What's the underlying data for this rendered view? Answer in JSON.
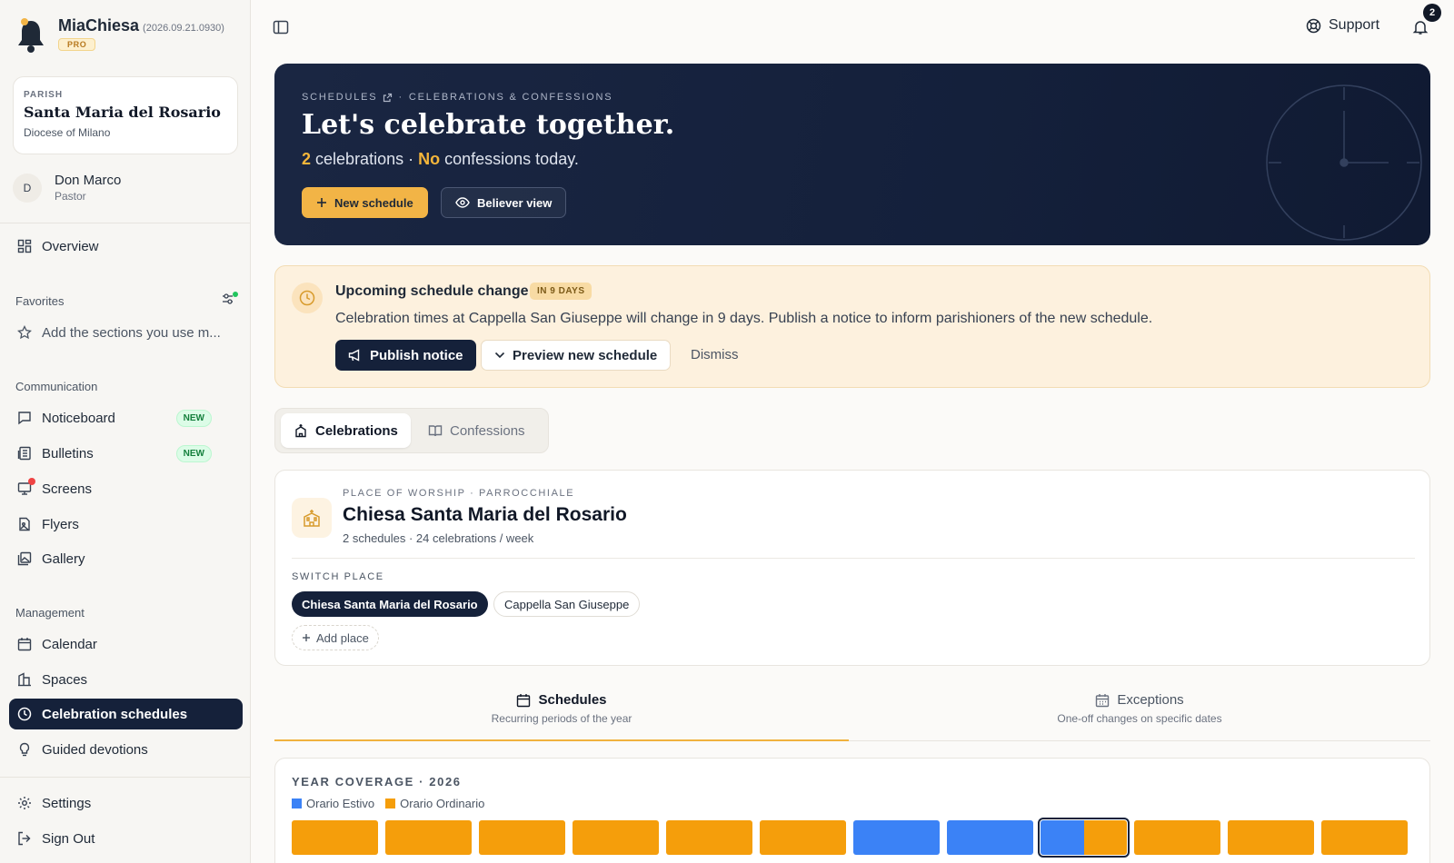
{
  "app": {
    "name": "MiaChiesa",
    "version": "(2026.09.21.0930)",
    "plan": "PRO"
  },
  "parish": {
    "kicker": "PARISH",
    "name": "Santa Maria del Rosario",
    "diocese": "Diocese of Milano"
  },
  "user": {
    "initial": "D",
    "name": "Don Marco",
    "role": "Pastor"
  },
  "sidebar": {
    "overview": "Overview",
    "favorites_heading": "Favorites",
    "favorites_hint": "Add the sections you use m...",
    "communication_heading": "Communication",
    "communication": [
      {
        "label": "Noticeboard",
        "badge": "NEW"
      },
      {
        "label": "Bulletins",
        "badge": "NEW"
      },
      {
        "label": "Screens"
      },
      {
        "label": "Flyers"
      },
      {
        "label": "Gallery"
      }
    ],
    "management_heading": "Management",
    "management": [
      {
        "label": "Calendar"
      },
      {
        "label": "Spaces"
      },
      {
        "label": "Celebration schedules"
      },
      {
        "label": "Guided devotions"
      }
    ],
    "settings": "Settings",
    "sign_out": "Sign Out"
  },
  "topbar": {
    "support": "Support",
    "notifications_count": "2"
  },
  "hero": {
    "crumb_1": "SCHEDULES",
    "crumb_sep": "·",
    "crumb_2": "CELEBRATIONS & CONFESSIONS",
    "title": "Let's celebrate together.",
    "sub_count": "2",
    "sub_mid": "celebrations ·",
    "sub_no": "No",
    "sub_end": "confessions today.",
    "new_schedule": "New schedule",
    "believer_view": "Believer view"
  },
  "notice": {
    "title": "Upcoming schedule change",
    "badge": "IN 9 DAYS",
    "text": "Celebration times at Cappella San Giuseppe will change in 9 days. Publish a notice to inform parishioners of the new schedule.",
    "publish": "Publish notice",
    "preview": "Preview new schedule",
    "dismiss": "Dismiss"
  },
  "tabs": {
    "celebrations": "Celebrations",
    "confessions": "Confessions"
  },
  "place": {
    "kicker": "PLACE OF WORSHIP · PARROCCHIALE",
    "name": "Chiesa Santa Maria del Rosario",
    "meta": "2 schedules · 24 celebrations / week",
    "switch_heading": "SWITCH PLACE",
    "chips": [
      "Chiesa Santa Maria del Rosario",
      "Cappella San Giuseppe"
    ],
    "add_place": "Add place"
  },
  "subtabs": {
    "schedules": {
      "title": "Schedules",
      "desc": "Recurring periods of the year"
    },
    "exceptions": {
      "title": "Exceptions",
      "desc": "One-off changes on specific dates"
    }
  },
  "coverage": {
    "heading": "YEAR COVERAGE · 2026",
    "legend": [
      {
        "label": "Orario Estivo",
        "color": "#3b82f6"
      },
      {
        "label": "Orario Ordinario",
        "color": "#f59e0b"
      }
    ],
    "months": [
      {
        "estivo": 0,
        "ordinario": 1
      },
      {
        "estivo": 0,
        "ordinario": 1
      },
      {
        "estivo": 0,
        "ordinario": 1
      },
      {
        "estivo": 0,
        "ordinario": 1
      },
      {
        "estivo": 0,
        "ordinario": 1
      },
      {
        "estivo": 0,
        "ordinario": 1
      },
      {
        "estivo": 1,
        "ordinario": 0
      },
      {
        "estivo": 1,
        "ordinario": 0
      },
      {
        "estivo": 0.5,
        "ordinario": 0.5,
        "current": true
      },
      {
        "estivo": 0,
        "ordinario": 1
      },
      {
        "estivo": 0,
        "ordinario": 1
      },
      {
        "estivo": 0,
        "ordinario": 1
      }
    ]
  },
  "colors": {
    "navy": "#15213a",
    "accent": "#f2b446",
    "estivo": "#3b82f6",
    "ordinario": "#f59e0b"
  }
}
